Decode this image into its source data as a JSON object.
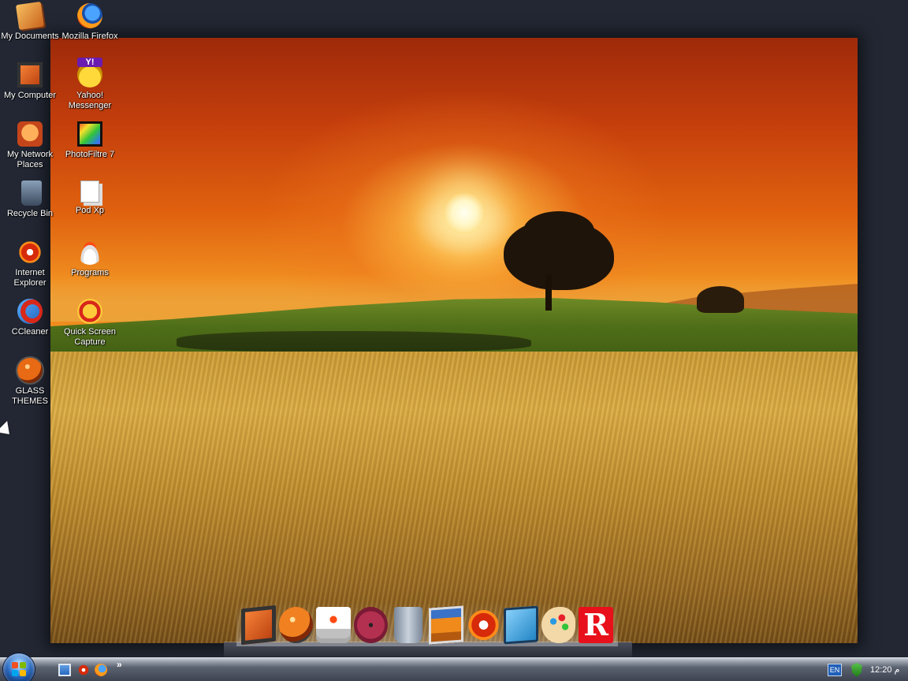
{
  "desktop": {
    "icons": [
      {
        "label": "My Documents",
        "icon": "my-documents-icon"
      },
      {
        "label": "Mozilla Firefox",
        "icon": "firefox-icon"
      },
      {
        "label": "My Computer",
        "icon": "my-computer-icon"
      },
      {
        "label": "Yahoo! Messenger",
        "icon": "yahoo-messenger-icon"
      },
      {
        "label": "My Network Places",
        "icon": "network-places-icon"
      },
      {
        "label": "PhotoFiltre 7",
        "icon": "photofiltre-icon"
      },
      {
        "label": "Recycle Bin",
        "icon": "recycle-bin-icon"
      },
      {
        "label": "Pod Xp",
        "icon": "pod-xp-icon"
      },
      {
        "label": "Internet Explorer",
        "icon": "internet-explorer-icon"
      },
      {
        "label": "Programs",
        "icon": "programs-icon"
      },
      {
        "label": "CCleaner",
        "icon": "ccleaner-icon"
      },
      {
        "label": "Quick Screen Capture",
        "icon": "quick-screen-capture-icon"
      },
      {
        "label": "GLASS THEMES",
        "icon": "glass-themes-icon"
      }
    ]
  },
  "dock": {
    "items": [
      {
        "icon": "computer-icon"
      },
      {
        "icon": "windows-orb-icon"
      },
      {
        "icon": "hard-drive-icon"
      },
      {
        "icon": "disc-icon"
      },
      {
        "icon": "trash-icon"
      },
      {
        "icon": "photo-icon"
      },
      {
        "icon": "internet-explorer-icon"
      },
      {
        "icon": "network-icon"
      },
      {
        "icon": "paint-palette-icon"
      },
      {
        "icon": "r-letter-icon",
        "text": "R"
      }
    ]
  },
  "taskbar": {
    "quicklaunch_more": "»",
    "tray": {
      "language": "EN",
      "clock": "12:20 م"
    }
  },
  "colors": {
    "desktop_bg": "#232834",
    "taskbar_top": "#c7ccd4",
    "taskbar_bottom": "#3d434f"
  }
}
